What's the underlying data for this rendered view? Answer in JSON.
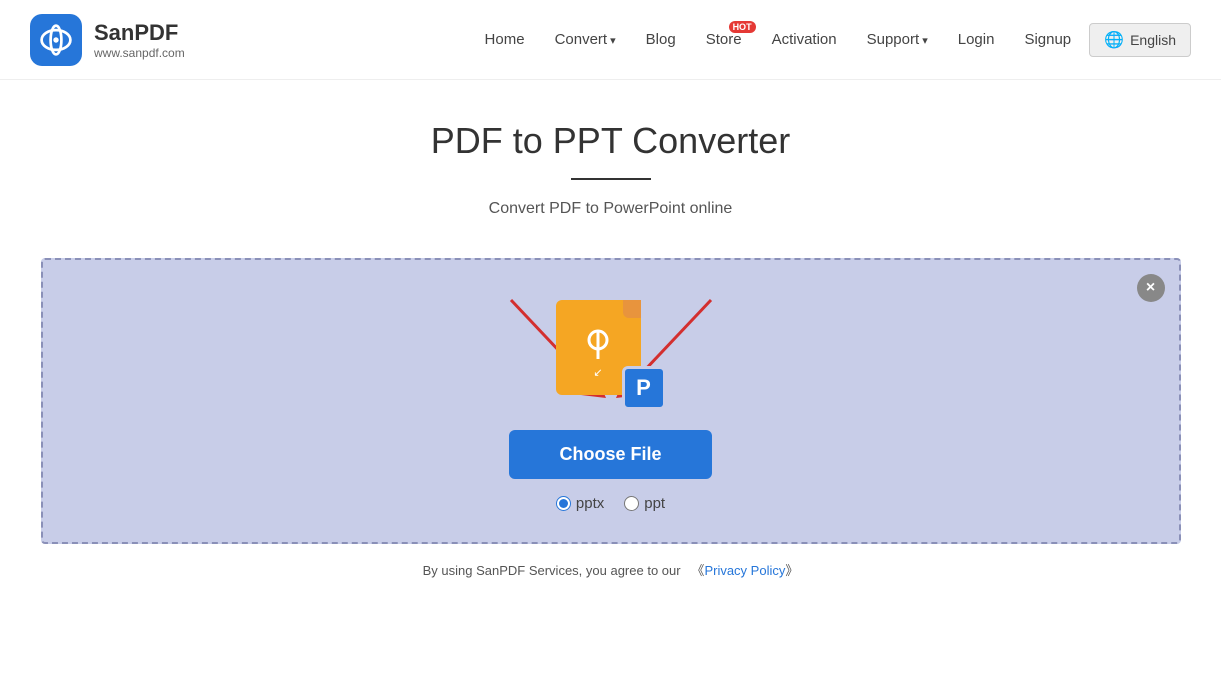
{
  "header": {
    "logo_name": "SanPDF",
    "logo_url": "www.sanpdf.com",
    "nav": {
      "home": "Home",
      "convert": "Convert",
      "blog": "Blog",
      "store": "Store",
      "hot_badge": "HOT",
      "activation": "Activation",
      "support": "Support",
      "login": "Login",
      "signup": "Signup",
      "language": "English"
    }
  },
  "main": {
    "page_title": "PDF to PPT Converter",
    "page_subtitle": "Convert PDF to PowerPoint online",
    "upload": {
      "choose_file_label": "Choose File",
      "close_label": "×",
      "radio_pptx": "pptx",
      "radio_ppt": "ppt"
    },
    "footer_text_before": "By using SanPDF Services, you agree to our",
    "footer_link_open": "《",
    "footer_link_text": "Privacy Policy",
    "footer_link_close": "》"
  }
}
